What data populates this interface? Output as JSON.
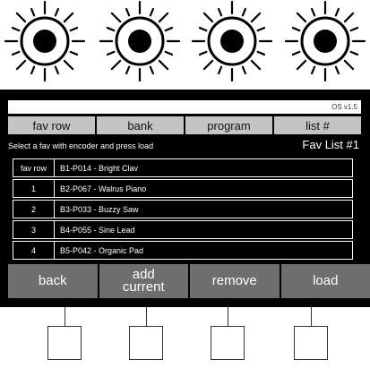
{
  "os_version": "OS v1.5",
  "tabs": [
    "fav row",
    "bank",
    "program",
    "list #"
  ],
  "hint": "Select a fav with encoder and press load",
  "fav_list_title": "Fav List #1",
  "list": {
    "header": {
      "num": "fav row",
      "name": "B1-P014 - Bright Clav"
    },
    "rows": [
      {
        "num": "1",
        "name": "B2-P067 - Walrus Piano"
      },
      {
        "num": "2",
        "name": "B3-P033 - Buzzy Saw"
      },
      {
        "num": "3",
        "name": "B4-P055 - Sine Lead"
      },
      {
        "num": "4",
        "name": "B5-P042 - Organic Pad"
      }
    ]
  },
  "actions": [
    "back",
    "add\ncurrent",
    "remove",
    "load"
  ],
  "knob_icons": [
    "knob-icon",
    "knob-icon",
    "knob-icon",
    "knob-icon"
  ],
  "colors": {
    "screen_bg": "#000000",
    "tab_bg": "#c4c4c4",
    "action_bg": "#6e6e6e",
    "text": "#ffffff"
  }
}
